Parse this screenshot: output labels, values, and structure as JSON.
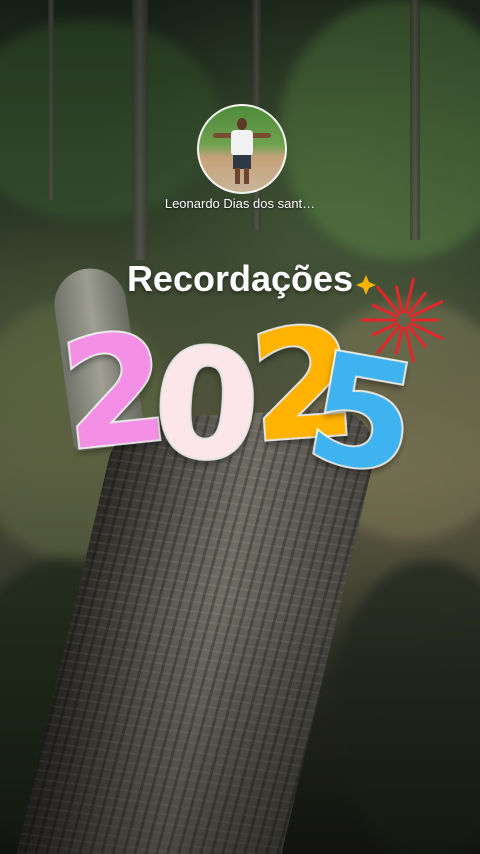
{
  "story": {
    "author_name": "Leonardo Dias dos sant…",
    "avatar_icon": "profile-photo",
    "title": "Recordações"
  },
  "sticker": {
    "year_digits": [
      "2",
      "0",
      "2",
      "5"
    ],
    "digit_colors": [
      "#f48fe6",
      "#fde6ea",
      "#ffb300",
      "#3fb3f0"
    ],
    "firework_color": "#e3262b",
    "sparkle_color": "#f4b400",
    "fireworks_icon": "fireworks-icon",
    "sparkle_icon": "sparkle-icon"
  }
}
